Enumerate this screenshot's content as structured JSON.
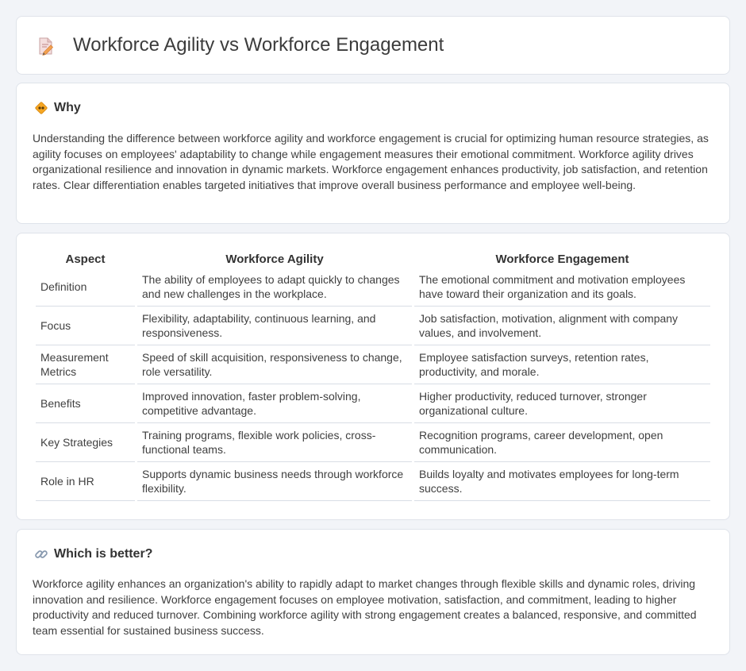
{
  "header": {
    "title": "Workforce Agility vs Workforce Engagement",
    "icon": "document-pencil-icon"
  },
  "why": {
    "title": "Why",
    "icon": "diamond-sign-icon",
    "text": "Understanding the difference between workforce agility and workforce engagement is crucial for optimizing human resource strategies, as agility focuses on employees' adaptability to change while engagement measures their emotional commitment. Workforce agility drives organizational resilience and innovation in dynamic markets. Workforce engagement enhances productivity, job satisfaction, and retention rates. Clear differentiation enables targeted initiatives that improve overall business performance and employee well-being."
  },
  "table": {
    "headers": [
      "Aspect",
      "Workforce Agility",
      "Workforce Engagement"
    ],
    "rows": [
      {
        "aspect": "Definition",
        "agility": "The ability of employees to adapt quickly to changes and new challenges in the workplace.",
        "engagement": "The emotional commitment and motivation employees have toward their organization and its goals."
      },
      {
        "aspect": "Focus",
        "agility": "Flexibility, adaptability, continuous learning, and responsiveness.",
        "engagement": "Job satisfaction, motivation, alignment with company values, and involvement."
      },
      {
        "aspect": "Measurement Metrics",
        "agility": "Speed of skill acquisition, responsiveness to change, role versatility.",
        "engagement": "Employee satisfaction surveys, retention rates, productivity, and morale."
      },
      {
        "aspect": "Benefits",
        "agility": "Improved innovation, faster problem-solving, competitive advantage.",
        "engagement": "Higher productivity, reduced turnover, stronger organizational culture."
      },
      {
        "aspect": "Key Strategies",
        "agility": "Training programs, flexible work policies, cross-functional teams.",
        "engagement": "Recognition programs, career development, open communication."
      },
      {
        "aspect": "Role in HR",
        "agility": "Supports dynamic business needs through workforce flexibility.",
        "engagement": "Builds loyalty and motivates employees for long-term success."
      }
    ]
  },
  "better": {
    "title": "Which is better?",
    "icon": "link-icon",
    "text": "Workforce agility enhances an organization's ability to rapidly adapt to market changes through flexible skills and dynamic roles, driving innovation and resilience. Workforce engagement focuses on employee motivation, satisfaction, and commitment, leading to higher productivity and reduced turnover. Combining workforce agility with strong engagement creates a balanced, responsive, and committed team essential for sustained business success."
  },
  "colors": {
    "background": "#f2f4f8",
    "card": "#ffffff",
    "text": "#3f3f3f",
    "icon_accent": "#f0a35a"
  }
}
